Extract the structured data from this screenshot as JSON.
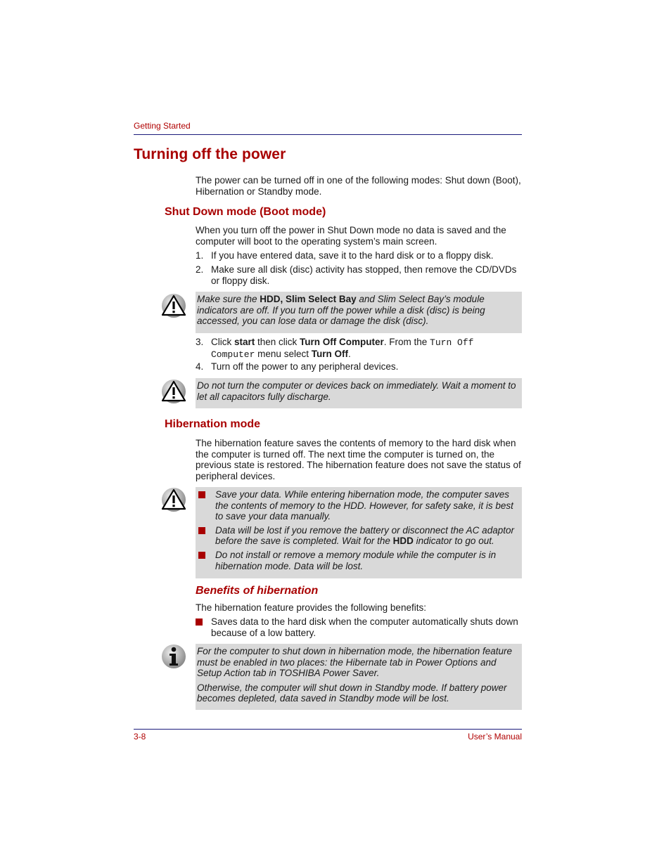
{
  "header": {
    "running_head": "Getting Started"
  },
  "title": "Turning off the power",
  "intro": "The power can be turned off in one of the following modes: Shut down (Boot), Hibernation or Standby mode.",
  "shutdown": {
    "heading": "Shut Down mode (Boot mode)",
    "intro": "When you turn off the power in Shut Down mode no data is saved and the computer will boot to the operating system’s main screen.",
    "steps": [
      {
        "num": "1.",
        "text": "If you have entered data, save it to the hard disk or to a floppy disk."
      },
      {
        "num": "2.",
        "text": "Make sure all disk (disc) activity has stopped, then remove the CD/DVDs or floppy disk."
      },
      {
        "num": "3.",
        "parts": {
          "a": "Click ",
          "b": "start",
          "c": " then click ",
          "d": "Turn Off Computer",
          "e": ". From the ",
          "f": "Turn Off Computer",
          "g": " menu select ",
          "h": "Turn Off",
          "i": "."
        }
      },
      {
        "num": "4.",
        "text": "Turn off the power to any peripheral devices."
      }
    ],
    "caution1": {
      "icon": "caution-icon",
      "a": "Make sure the ",
      "b": "HDD, Slim Select Bay",
      "c": " and Slim Select Bay’s module indicators are off. If you turn off the power while a disk (disc) is being accessed, you can lose data or damage the disk (disc)."
    },
    "caution2": {
      "icon": "caution-icon",
      "text": "Do not turn the computer or devices back on immediately. Wait a moment to let all capacitors fully discharge."
    }
  },
  "hibernation": {
    "heading": "Hibernation mode",
    "intro": "The hibernation feature saves the contents of memory to the hard disk when the computer is turned off. The next time the computer is turned on, the previous state is restored. The hibernation feature does not save the status of peripheral devices.",
    "caution": {
      "icon": "caution-icon",
      "items": [
        {
          "text": "Save your data. While entering hibernation mode, the computer saves the contents of memory to the HDD. However, for safety sake, it is best to save your data manually."
        },
        {
          "a": "Data will be lost if you remove the battery or disconnect the AC adaptor before the save is completed. Wait for the ",
          "b": "HDD",
          "c": " indicator to go out."
        },
        {
          "text": "Do not install or remove a memory module while the computer is in hibernation mode. Data will be lost."
        }
      ]
    },
    "benefits": {
      "heading": "Benefits of hibernation",
      "intro": "The hibernation feature provides the following benefits:",
      "items": [
        "Saves data to the hard disk when the computer automatically shuts down because of a low battery."
      ]
    },
    "info_note": {
      "icon": "info-icon",
      "paragraphs": [
        "For the computer to shut down in hibernation mode, the hibernation feature must be enabled in two places: the Hibernate tab in Power Options and Setup Action tab in TOSHIBA Power Saver.",
        "Otherwise, the computer will shut down in Standby mode. If battery power becomes depleted, data saved in Standby mode will be lost."
      ]
    }
  },
  "footer": {
    "page_number": "3-8",
    "manual_title": "User’s Manual"
  },
  "colors": {
    "accent_red": "#a80000",
    "rule_blue": "#1a1a7a",
    "note_gray": "#d9d9d9"
  }
}
